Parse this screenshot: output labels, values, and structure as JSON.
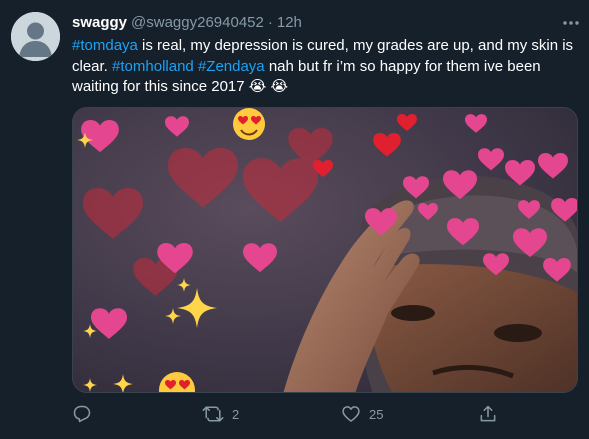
{
  "tweet": {
    "display_name": "swaggy",
    "handle": "@swaggy26940452",
    "separator": "·",
    "time": "12h",
    "text_segments": [
      {
        "text": "#tomdaya",
        "type": "hashtag"
      },
      {
        "text": " is real, my depression is cured, my grades are up, and my skin is clear. ",
        "type": "text"
      },
      {
        "text": "#tomholland",
        "type": "hashtag"
      },
      {
        "text": " ",
        "type": "text"
      },
      {
        "text": "#Zendaya",
        "type": "hashtag"
      },
      {
        "text": " nah but fr i’m so happy for them ive been waiting for this since 2017 ",
        "type": "text"
      },
      {
        "text": "😭 😭",
        "type": "emoji"
      }
    ],
    "media_alt": "meme photo: man in durag with hand on head surrounded by floating hearts, sparkles and heart-eyes emojis"
  },
  "actions": {
    "reply": {
      "icon": "reply-icon",
      "count": ""
    },
    "retweet": {
      "icon": "retweet-icon",
      "count": "2"
    },
    "like": {
      "icon": "heart-icon",
      "count": "25"
    },
    "share": {
      "icon": "share-icon",
      "count": ""
    }
  },
  "colors": {
    "background": "#15202b",
    "text": "#ffffff",
    "secondary": "#8899a6",
    "link": "#1da1f2",
    "border": "#38444d"
  }
}
